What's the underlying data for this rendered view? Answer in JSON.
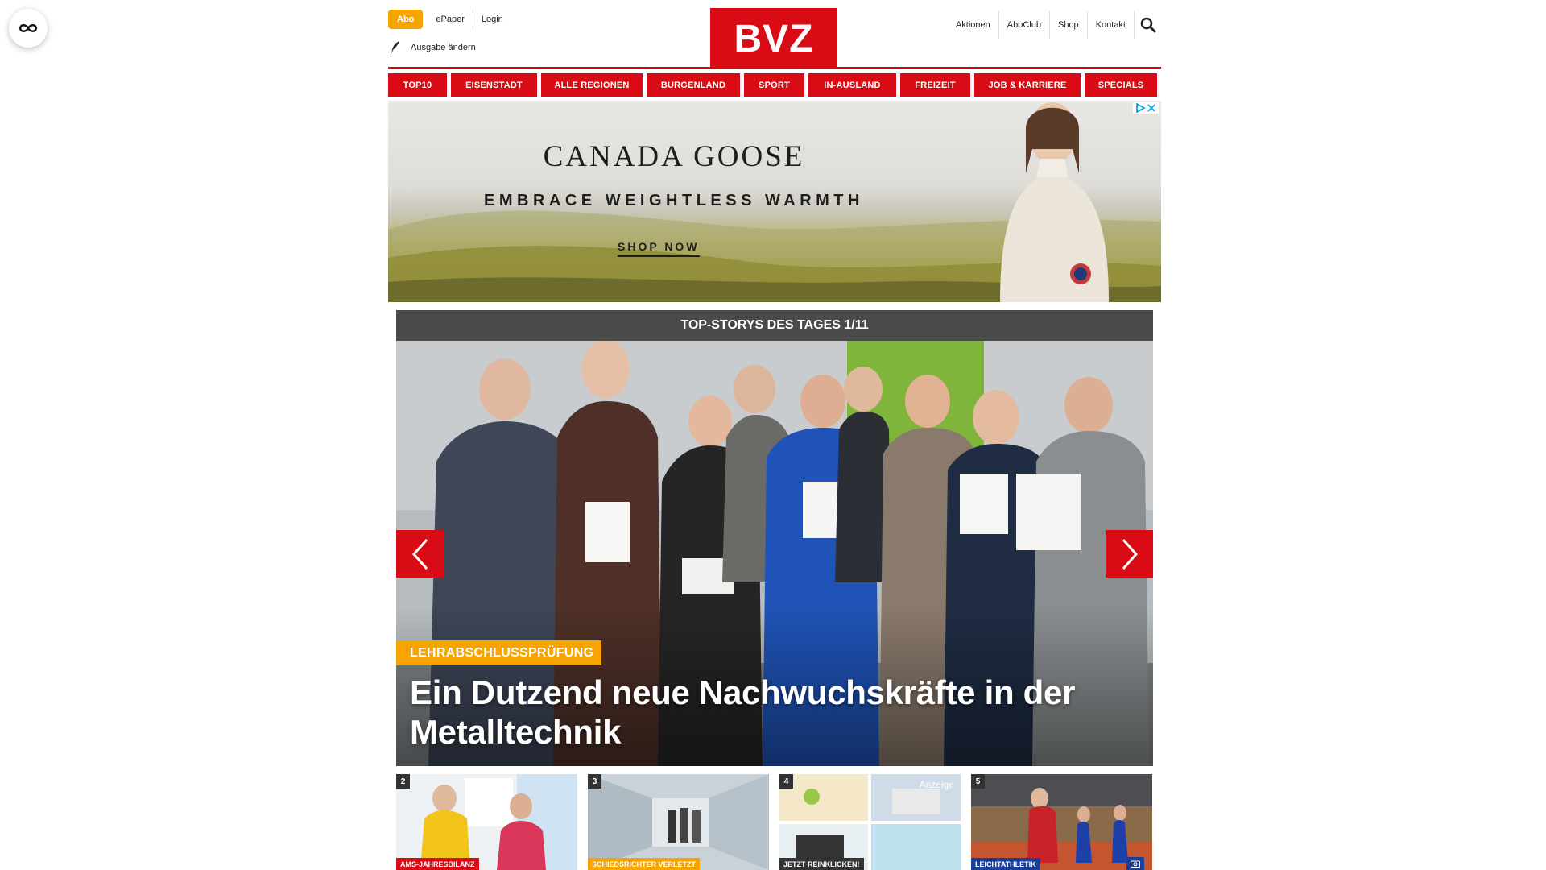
{
  "header": {
    "abo": "Abo",
    "epaper": "ePaper",
    "login": "Login",
    "edition": "Ausgabe ändern",
    "logo": "BVZ",
    "right_links": [
      "Aktionen",
      "AboClub",
      "Shop",
      "Kontakt"
    ]
  },
  "nav": {
    "items": [
      "TOP10",
      "EISENSTADT",
      "ALLE REGIONEN",
      "BURGENLAND",
      "SPORT",
      "IN-AUSLAND",
      "FREIZEIT",
      "JOB & KARRIERE",
      "SPECIALS"
    ]
  },
  "ad": {
    "brand": "CANADA GOOSE",
    "tagline": "EMBRACE WEIGHTLESS WARMTH",
    "cta": "SHOP NOW"
  },
  "top_stories": {
    "header": "TOP-STORYS DES TAGES 1/11",
    "kicker": "LEHRABSCHLUSSPRÜFUNG",
    "headline": "Ein Dutzend neue Nachwuchskräfte in der Metalltechnik"
  },
  "thumbs": [
    {
      "num": "2",
      "tag": "AMS-JAHRESBILANZ",
      "color": "#d90b14"
    },
    {
      "num": "3",
      "tag": "SCHIEDSRICHTER VERLETZT",
      "color": "#f5a400"
    },
    {
      "num": "4",
      "tag": "JETZT REINKLICKEN!",
      "color": "#333333",
      "badge": "Anzeige"
    },
    {
      "num": "5",
      "tag": "LEICHTATHLETIK",
      "color": "#1a3f9a"
    }
  ],
  "colors": {
    "brand_red": "#d90b14",
    "accent_orange": "#f5a400",
    "dark_bar": "#4a4a4a"
  }
}
